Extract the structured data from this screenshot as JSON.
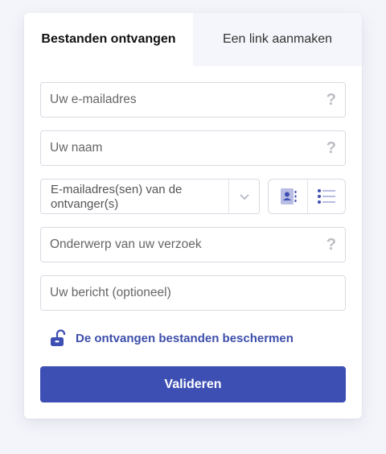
{
  "tabs": [
    {
      "label": "Bestanden ontvangen",
      "active": true
    },
    {
      "label": "Een link aanmaken",
      "active": false
    }
  ],
  "form": {
    "email_placeholder": "Uw e-mailadres",
    "name_placeholder": "Uw naam",
    "recipients_placeholder": "E-mailadres(sen) van de ontvanger(s)",
    "subject_placeholder": "Onderwerp van uw verzoek",
    "message_placeholder": "Uw bericht (optioneel)",
    "help_glyph": "?"
  },
  "protect": {
    "label": "De ontvangen bestanden beschermen",
    "icon": "unlock-icon"
  },
  "submit_label": "Valideren",
  "colors": {
    "accent": "#3e4fb3",
    "link": "#3d4eaa",
    "icon_muted": "#b8bde3"
  }
}
